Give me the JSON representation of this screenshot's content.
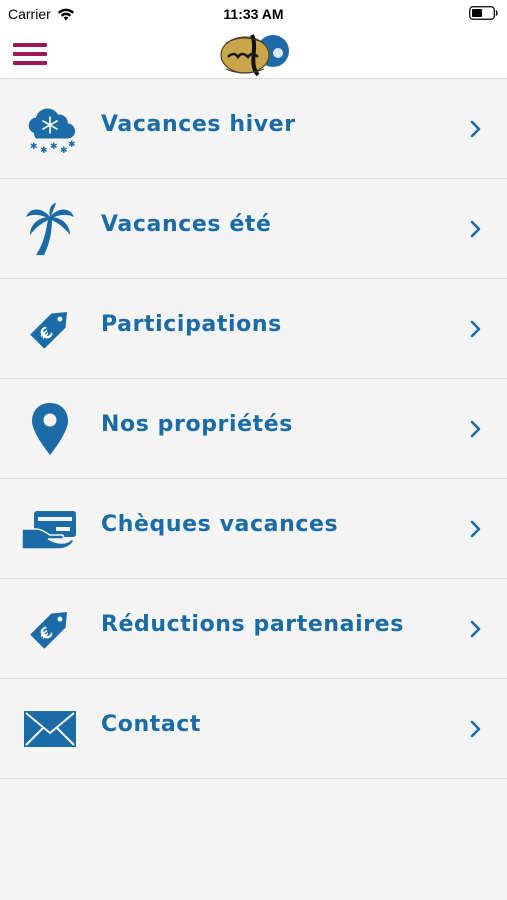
{
  "status_bar": {
    "carrier": "Carrier",
    "time": "11:33 AM"
  },
  "colors": {
    "accent": "#1b6ca6",
    "menu_icon": "#9b1a54"
  },
  "menu": [
    {
      "label": "Vacances hiver",
      "icon": "snow-cloud-icon"
    },
    {
      "label": "Vacances été",
      "icon": "palm-tree-icon"
    },
    {
      "label": "Participations",
      "icon": "euro-tag-icon"
    },
    {
      "label": "Nos propriétés",
      "icon": "map-pin-icon"
    },
    {
      "label": "Chèques vacances",
      "icon": "card-hand-icon"
    },
    {
      "label": "Réductions partenaires",
      "icon": "euro-tag-icon"
    },
    {
      "label": "Contact",
      "icon": "envelope-icon"
    }
  ]
}
